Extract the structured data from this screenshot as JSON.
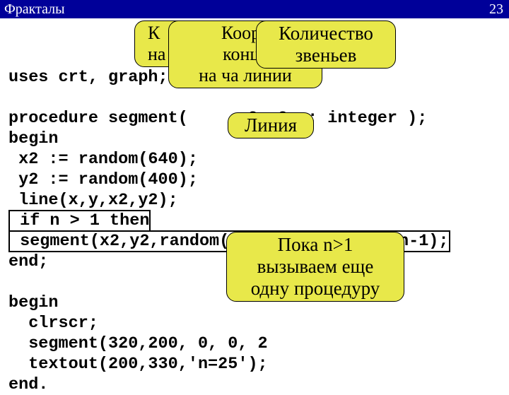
{
  "titlebar": {
    "title": "Фракталы",
    "page": "23"
  },
  "code": {
    "l1": "uses crt, graph;",
    "l2": "",
    "l3": "procedure segment(    ,x2,y2,n: integer );",
    "l4": "begin",
    "l5": " x2 := random(640);",
    "l6": " y2 := random(400);",
    "l7": " line(x,y,x2,y2);",
    "l8": " if n > 1 then",
    "l9": " segment(x2,y2,random(640),random(400),n-1);",
    "l10": "end;",
    "l11": "",
    "l12": "begin",
    "l13": "  clrscr;",
    "l14": "  segment(320,200, 0, 0, 2",
    "l15": "  textout(200,330,'n=25');",
    "l16": "end."
  },
  "callouts": {
    "c1": "К",
    "c2": "на",
    "c3a": "Коорд",
    "c3b": "конца",
    "c3c": "на ча линии",
    "c4a": "Количество",
    "c4b": "звеньев",
    "c5": "Линия",
    "c6a": "Пока n>1",
    "c6b": "вызываем еще",
    "c6c": "одну процедуру"
  }
}
